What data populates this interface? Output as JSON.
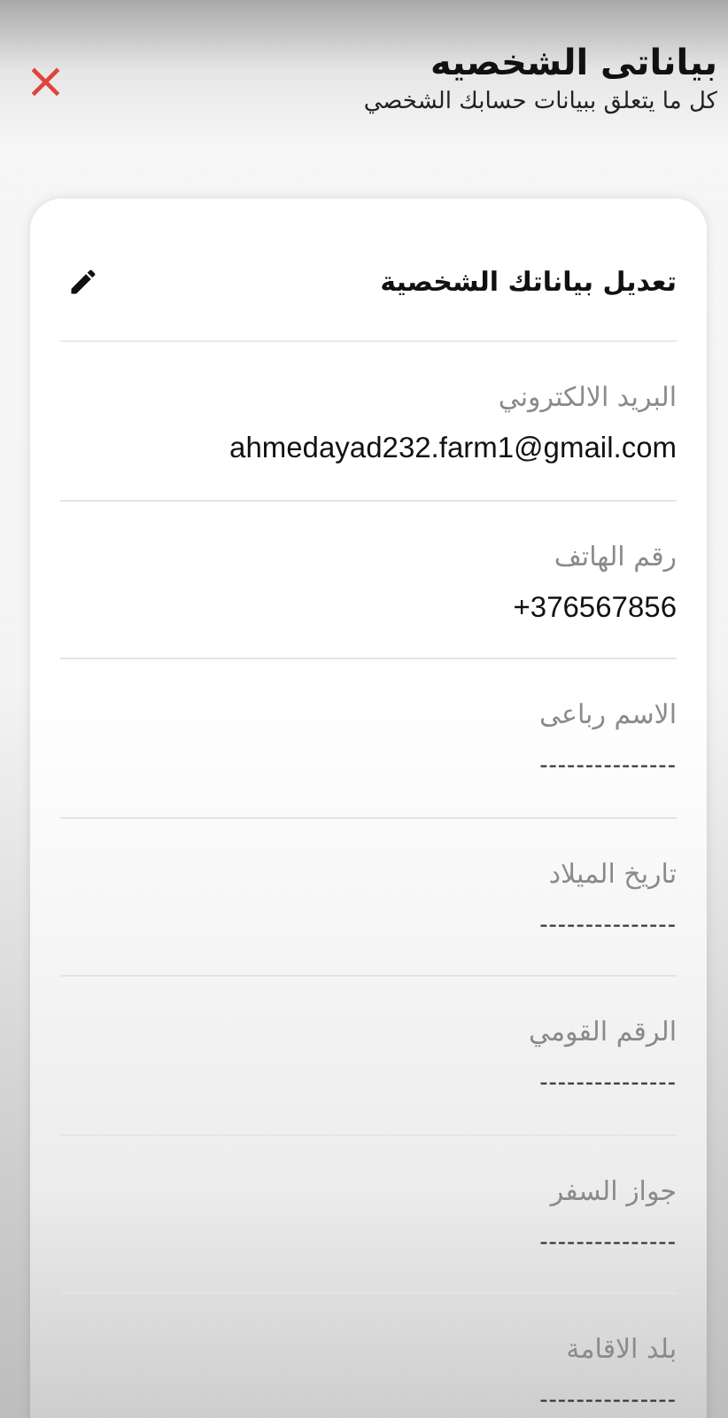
{
  "header": {
    "title": "بياناتى الشخصيه",
    "subtitle": "كل ما يتعلق ببيانات حسابك الشخصي",
    "close": "×"
  },
  "card": {
    "title": "تعديل بياناتك الشخصية"
  },
  "fields": [
    {
      "label": "البريد الالكتروني",
      "value": "ahmedayad232.farm1@gmail.com",
      "filled": true
    },
    {
      "label": "رقم الهاتف",
      "value": "+376567856",
      "filled": true
    },
    {
      "label": "الاسم رباعى",
      "value": "---------------",
      "filled": false
    },
    {
      "label": "تاريخ الميلاد",
      "value": "---------------",
      "filled": false
    },
    {
      "label": "الرقم القومي",
      "value": "---------------",
      "filled": false
    },
    {
      "label": "جواز السفر",
      "value": "---------------",
      "filled": false
    },
    {
      "label": "بلد الاقامة",
      "value": "---------------",
      "filled": false
    }
  ]
}
